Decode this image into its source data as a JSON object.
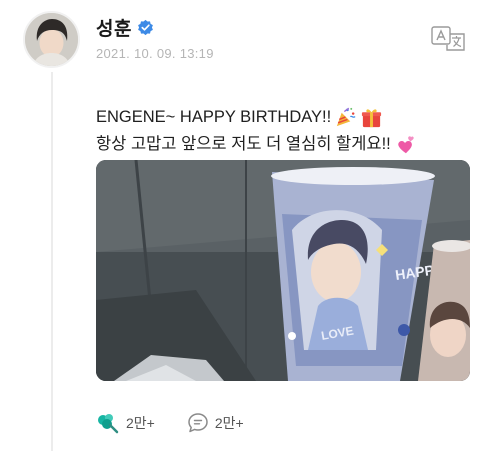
{
  "post": {
    "author_name": "성훈",
    "timestamp": "2021. 10. 09. 13:19",
    "text_line1": "ENGENE~ HAPPY BIRTHDAY!!",
    "text_line2": "항상 고맙고 앞으로 저도 더 열심히 할게요!!",
    "emojis": [
      "party-popper",
      "gift",
      "two-hearts"
    ]
  },
  "actions": {
    "likes_count": "2만+",
    "comments_count": "2만+"
  },
  "icons": {
    "verified": "verified-badge-icon",
    "translate": "translate-icon",
    "like": "like-icon",
    "comment": "comment-icon"
  },
  "colors": {
    "verified_blue": "#3d8ae6",
    "like_teal": "#17b5a3",
    "gift_red": "#e8453c",
    "heart_pink": "#ee5aa6"
  }
}
